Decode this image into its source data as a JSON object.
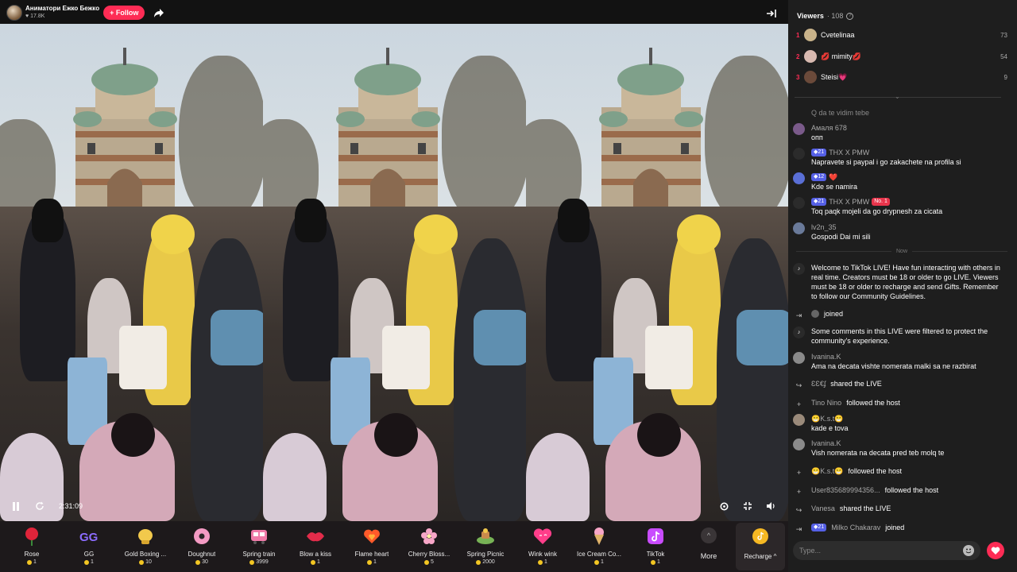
{
  "host": {
    "name": "Аниматори Ежко Бежко",
    "likes": "17.8K",
    "follow_label": "+ Follow"
  },
  "player": {
    "time": "2:31:09"
  },
  "gifts": [
    {
      "name": "Rose",
      "price": "1",
      "icon": "rose-icon"
    },
    {
      "name": "GG",
      "price": "1",
      "icon": "gg-icon"
    },
    {
      "name": "Gold Boxing ...",
      "price": "10",
      "icon": "boxing-glove-icon"
    },
    {
      "name": "Doughnut",
      "price": "30",
      "icon": "doughnut-icon"
    },
    {
      "name": "Spring train",
      "price": "3999",
      "icon": "train-icon"
    },
    {
      "name": "Blow a kiss",
      "price": "1",
      "icon": "lips-icon"
    },
    {
      "name": "Flame heart",
      "price": "1",
      "icon": "flame-heart-icon"
    },
    {
      "name": "Cherry Bloss...",
      "price": "5",
      "icon": "cherry-blossom-icon"
    },
    {
      "name": "Spring Picnic",
      "price": "2000",
      "icon": "picnic-icon"
    },
    {
      "name": "Wink wink",
      "price": "1",
      "icon": "wink-heart-icon"
    },
    {
      "name": "Ice Cream Co...",
      "price": "1",
      "icon": "ice-cream-icon"
    },
    {
      "name": "TikTok",
      "price": "1",
      "icon": "tiktok-icon"
    }
  ],
  "more_label": "More",
  "recharge_label": "Recharge ^",
  "viewers": {
    "title": "Viewers",
    "count": "· 108",
    "top": [
      {
        "rank": "1",
        "name": "Cvetelinaa",
        "score": "73"
      },
      {
        "rank": "2",
        "name": "💋 mimity💋",
        "score": "54"
      },
      {
        "rank": "3",
        "name": "Steisi💗",
        "score": "9"
      }
    ]
  },
  "chat": {
    "partial_top": "Q da te vidim tebe",
    "messages": [
      {
        "user": "Амаля 678",
        "text": "опп"
      },
      {
        "level": "21",
        "user": "THX X PMW",
        "text": "Napravete si paypal i go zakachete na profila si"
      },
      {
        "level": "12",
        "user": "❤️",
        "text": "Kde se namira"
      },
      {
        "level": "21",
        "user": "THX X PMW",
        "badge": "No. 1",
        "text": "Toq paqk mojeli da go drypnesh za cicata"
      },
      {
        "user": "lv2n_35",
        "text": "Gospodi Dai mi sili"
      }
    ],
    "now_label": "Now",
    "welcome": "Welcome to TikTok LIVE! Have fun interacting with others in real time. Creators must be 18 or older to go LIVE. Viewers must be 18 or older to recharge and send Gifts. Remember to follow our Community Guidelines.",
    "joined_1": "joined",
    "filtered": "Some comments in this LIVE were filtered to protect the community's experience.",
    "msg_ivanina_1_user": "Ivanina.K",
    "msg_ivanina_1_text": "Ama na decata vishte nomerata malki sa ne razbirat",
    "share_1_user": "ƐƐ€ʄ",
    "share_1_text": "shared the LIVE",
    "follow_1_user": "Tino Nino",
    "follow_1_text": "followed the host",
    "kst_user": "😁K.s.t😁",
    "kst_text": "kade e tova",
    "msg_ivanina_2_user": "Ivanina.K",
    "msg_ivanina_2_text": "Vish nomerata na decata pred teb molq te",
    "follow_2_user": "😁K.s.t😁",
    "follow_2_text": "followed the host",
    "follow_3_user": "User835689994356...",
    "follow_3_text": "followed the host",
    "share_2_user": "Vanesa",
    "share_2_text": "shared the LIVE",
    "join_2_level": "21",
    "join_2_user": "Milko Chakarav",
    "join_2_text": "joined"
  },
  "input": {
    "placeholder": "Type..."
  },
  "colors": {
    "accent": "#fe2c55",
    "level_badge": "#5560e6",
    "coin": "#f3c623"
  }
}
